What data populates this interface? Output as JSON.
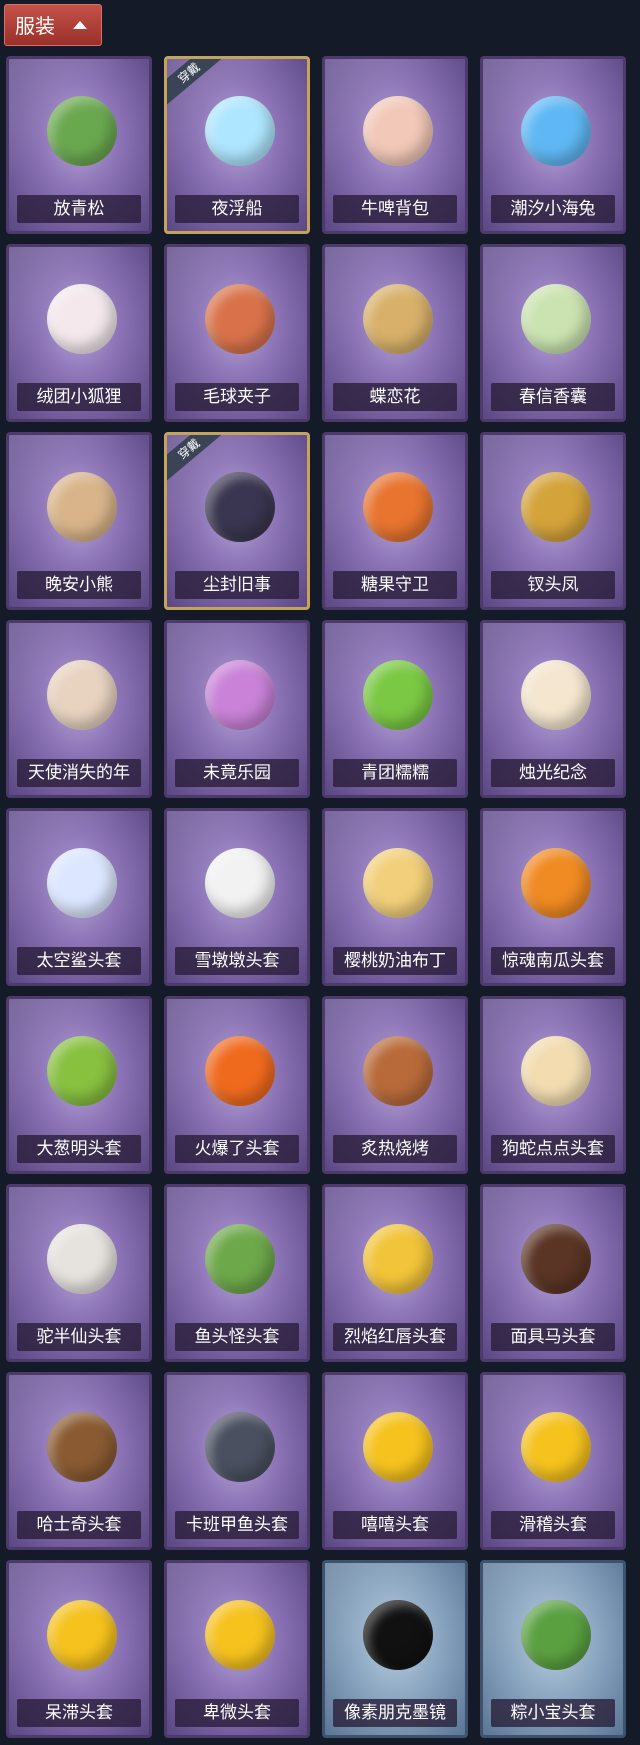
{
  "header": {
    "label": "服装"
  },
  "badge_text": "穿戴",
  "items": [
    {
      "name": "放青松",
      "color": "#6aa84f",
      "bg": "purple",
      "worn": false,
      "icon": "bonsai-pine-icon"
    },
    {
      "name": "夜浮船",
      "color": "#aee6ff",
      "bg": "purple",
      "worn": true,
      "icon": "jellyfish-ship-icon"
    },
    {
      "name": "牛啤背包",
      "color": "#f2c8b8",
      "bg": "purple",
      "worn": false,
      "icon": "cow-beer-backpack-icon"
    },
    {
      "name": "潮汐小海兔",
      "color": "#5fb8f5",
      "bg": "purple",
      "worn": false,
      "icon": "sea-bunny-icon"
    },
    {
      "name": "绒团小狐狸",
      "color": "#f4e8ec",
      "bg": "purple",
      "worn": false,
      "icon": "fluffy-fox-icon"
    },
    {
      "name": "毛球夹子",
      "color": "#d9724a",
      "bg": "purple",
      "worn": false,
      "icon": "nutcracker-raccoon-icon"
    },
    {
      "name": "蝶恋花",
      "color": "#d8b06a",
      "bg": "purple",
      "worn": false,
      "icon": "butterfly-flower-wreath-icon"
    },
    {
      "name": "春信香囊",
      "color": "#cbe3b0",
      "bg": "purple",
      "worn": false,
      "icon": "sachet-icon"
    },
    {
      "name": "晚安小熊",
      "color": "#d9b48a",
      "bg": "purple",
      "worn": false,
      "icon": "teddy-bear-icon"
    },
    {
      "name": "尘封旧事",
      "color": "#3a3550",
      "bg": "purple",
      "worn": true,
      "icon": "chibi-figure-icon"
    },
    {
      "name": "糖果守卫",
      "color": "#e8742f",
      "bg": "purple",
      "worn": false,
      "icon": "pumpkin-scarecrow-icon"
    },
    {
      "name": "钗头凤",
      "color": "#d4a33a",
      "bg": "purple",
      "worn": false,
      "icon": "phoenix-crown-doll-icon"
    },
    {
      "name": "天使消失的年",
      "color": "#e8d2c0",
      "bg": "purple",
      "worn": false,
      "icon": "angel-doll-icon"
    },
    {
      "name": "未竟乐园",
      "color": "#c982d8",
      "bg": "purple",
      "worn": false,
      "icon": "fairy-doll-icon"
    },
    {
      "name": "青团糯糯",
      "color": "#7ac843",
      "bg": "purple",
      "worn": false,
      "icon": "green-rice-ball-icon"
    },
    {
      "name": "烛光纪念",
      "color": "#f4e6cf",
      "bg": "purple",
      "worn": false,
      "icon": "candle-icon"
    },
    {
      "name": "太空鲨头套",
      "color": "#dce6ff",
      "bg": "purple",
      "worn": false,
      "icon": "space-shark-head-icon"
    },
    {
      "name": "雪墩墩头套",
      "color": "#f2f2f2",
      "bg": "purple",
      "worn": false,
      "icon": "snowman-head-icon"
    },
    {
      "name": "樱桃奶油布丁",
      "color": "#f2cf7a",
      "bg": "purple",
      "worn": false,
      "icon": "pudding-head-icon"
    },
    {
      "name": "惊魂南瓜头套",
      "color": "#f08a22",
      "bg": "purple",
      "worn": false,
      "icon": "pumpkin-head-icon"
    },
    {
      "name": "大葱明头套",
      "color": "#88c040",
      "bg": "purple",
      "worn": false,
      "icon": "scallion-head-icon"
    },
    {
      "name": "火爆了头套",
      "color": "#f06a1e",
      "bg": "purple",
      "worn": false,
      "icon": "fire-head-icon"
    },
    {
      "name": "炙热烧烤",
      "color": "#b86a3a",
      "bg": "purple",
      "worn": false,
      "icon": "bbq-meat-head-icon"
    },
    {
      "name": "狗蛇点点头套",
      "color": "#f2dcb0",
      "bg": "purple",
      "worn": false,
      "icon": "snake-dog-head-icon"
    },
    {
      "name": "驼半仙头套",
      "color": "#e6e2de",
      "bg": "purple",
      "worn": false,
      "icon": "polar-bear-head-icon"
    },
    {
      "name": "鱼头怪头套",
      "color": "#6da84a",
      "bg": "purple",
      "worn": false,
      "icon": "fish-head-icon"
    },
    {
      "name": "烈焰红唇头套",
      "color": "#f2c43a",
      "bg": "purple",
      "worn": false,
      "icon": "pikachu-head-icon"
    },
    {
      "name": "面具马头套",
      "color": "#5a3424",
      "bg": "purple",
      "worn": false,
      "icon": "horse-head-icon"
    },
    {
      "name": "哈士奇头套",
      "color": "#8a5a32",
      "bg": "purple",
      "worn": false,
      "icon": "husky-head-icon"
    },
    {
      "name": "卡班甲鱼头套",
      "color": "#4a5060",
      "bg": "purple",
      "worn": false,
      "icon": "turtle-head-icon"
    },
    {
      "name": "嘻嘻头套",
      "color": "#f6c21e",
      "bg": "purple",
      "worn": false,
      "icon": "grin-emoji-head-icon"
    },
    {
      "name": "滑稽头套",
      "color": "#f6c21e",
      "bg": "purple",
      "worn": false,
      "icon": "smirk-emoji-head-icon"
    },
    {
      "name": "呆滞头套",
      "color": "#f6c21e",
      "bg": "purple",
      "worn": false,
      "icon": "dazed-emoji-head-icon"
    },
    {
      "name": "卑微头套",
      "color": "#f6c21e",
      "bg": "purple",
      "worn": false,
      "icon": "humble-emoji-head-icon"
    },
    {
      "name": "像素朋克墨镜",
      "color": "#111111",
      "bg": "blue",
      "worn": false,
      "icon": "pixel-sunglasses-icon"
    },
    {
      "name": "粽小宝头套",
      "color": "#5aa040",
      "bg": "blue",
      "worn": false,
      "icon": "zongzi-head-icon"
    }
  ]
}
